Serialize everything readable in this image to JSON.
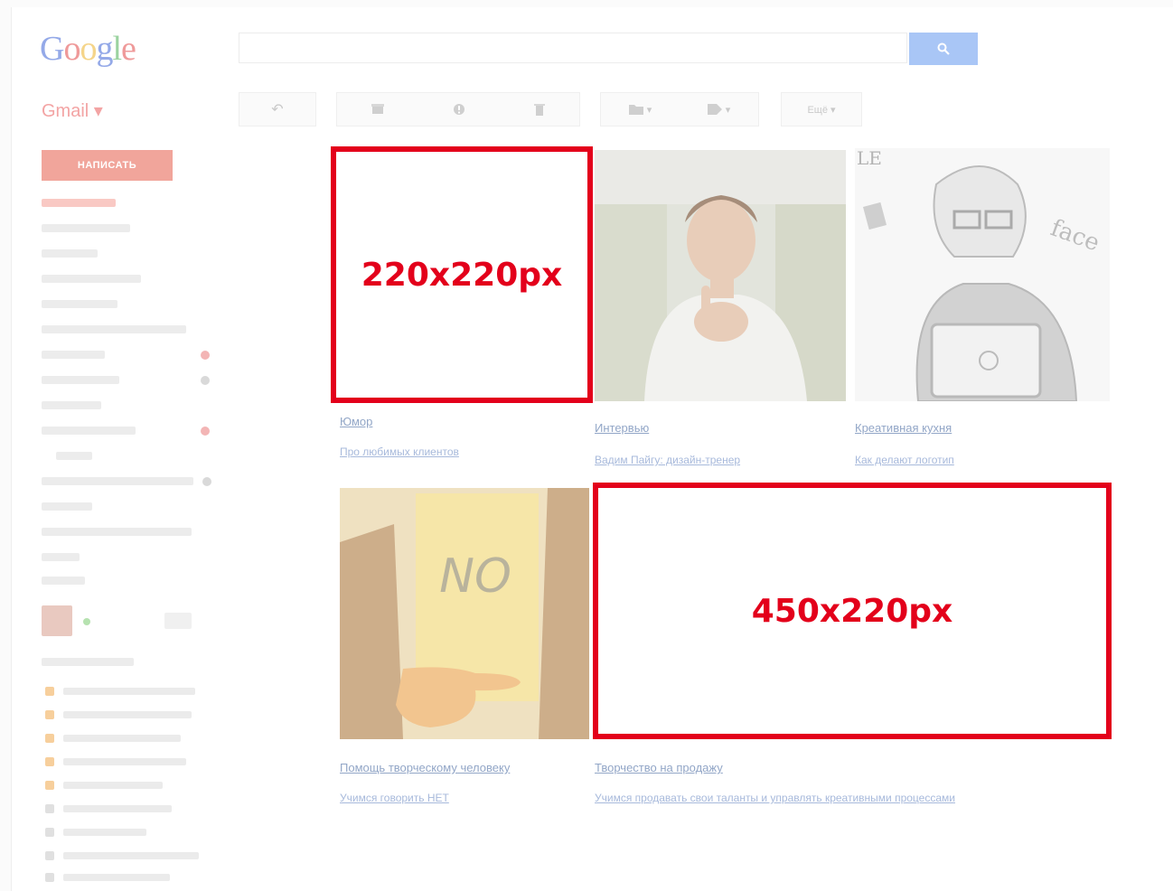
{
  "header": {
    "logo_letters": [
      "G",
      "o",
      "o",
      "g",
      "l",
      "e"
    ],
    "search_icon": "search-icon"
  },
  "app_switch": {
    "label": "Gmail ▾"
  },
  "toolbar": {
    "more_label": "Ещё ▾",
    "icons": [
      "reply-icon",
      "archive-icon",
      "spam-icon",
      "delete-icon",
      "folder-icon",
      "label-icon"
    ]
  },
  "compose": {
    "label": "НАПИСАТЬ"
  },
  "cards": [
    {
      "title": "Юмор",
      "subtitle": "Про любимых клиентов"
    },
    {
      "title": "Интервью",
      "subtitle": "Вадим Пайгу: дизайн-тренер"
    },
    {
      "title": "Креативная кухня",
      "subtitle": "Как делают логотип"
    },
    {
      "title": "Помощь творческому человеку",
      "subtitle": "Учимся говорить НЕТ"
    },
    {
      "title": "Творчество на продажу",
      "subtitle": "Учимся продавать свои таланты и управлять креативными процессами"
    }
  ],
  "placeholders": {
    "small": "220x220px",
    "wide": "450x220px"
  },
  "images": {
    "no_sign_text": "NO",
    "cartoon_text_top": "LE",
    "cartoon_text_side": "face"
  },
  "colors": {
    "accent_red": "#e3001b",
    "compose_bg": "#f1a59b",
    "search_btn": "#a9c6f6"
  }
}
